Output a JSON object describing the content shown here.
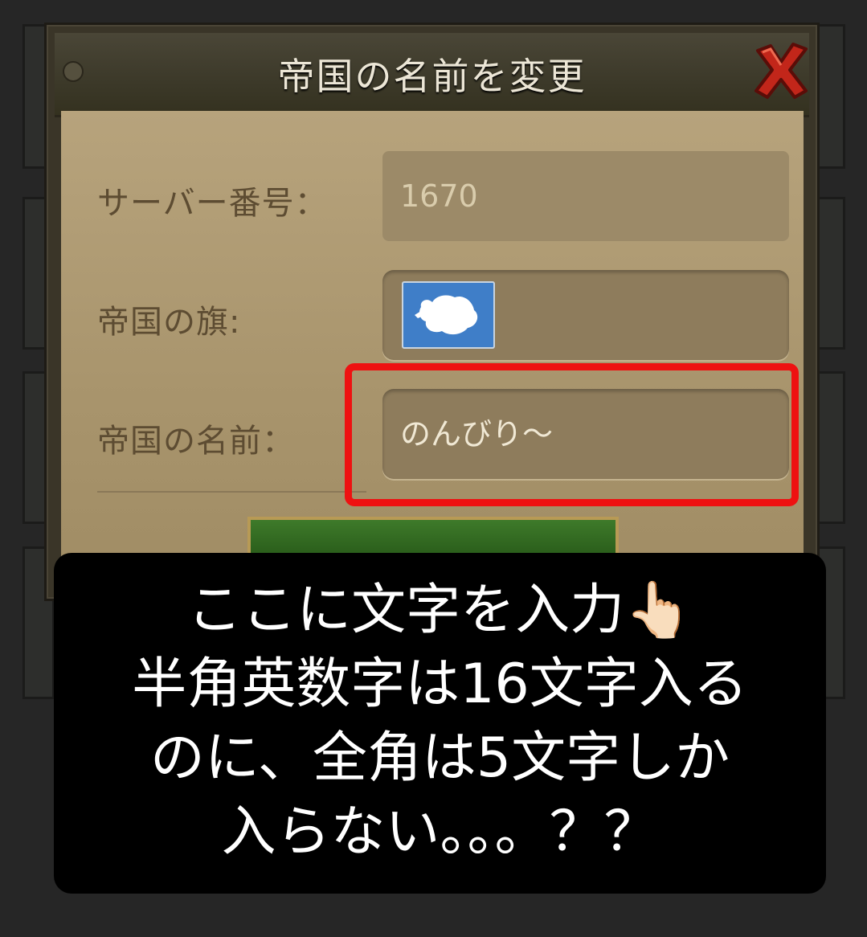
{
  "dialog": {
    "title": "帝国の名前を変更",
    "close_icon": "close-x-icon"
  },
  "form": {
    "server_label": "サーバー番号：",
    "server_value": "1670",
    "flag_label": "帝国の旗:",
    "flag_icon": "antarctica-flag-icon",
    "name_label": "帝国の名前：",
    "name_value": "のんびり～"
  },
  "caption": {
    "line1": "ここに文字を入力👆🏻",
    "line2": "半角英数字は16文字入る",
    "line3": "のに、全角は5文字しか",
    "line4": "入らない。。。？？"
  },
  "colors": {
    "highlight": "#ee1111",
    "caption_bg": "#000000",
    "caption_text": "#ffffff",
    "parchment": "#a8946c"
  }
}
